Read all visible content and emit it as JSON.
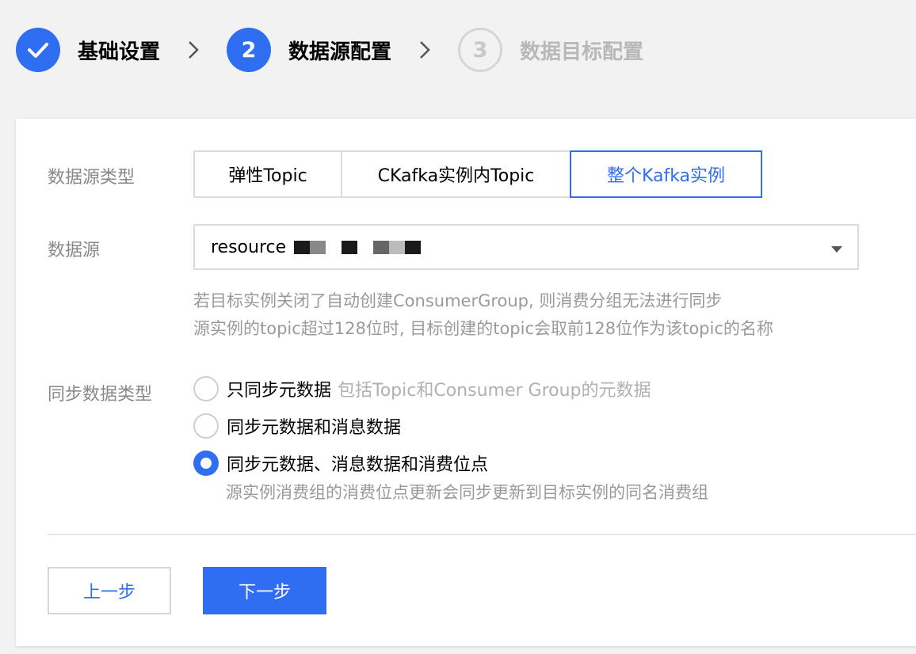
{
  "stepper": {
    "steps": [
      {
        "number": "",
        "label": "基础设置",
        "state": "done"
      },
      {
        "number": "2",
        "label": "数据源配置",
        "state": "active"
      },
      {
        "number": "3",
        "label": "数据目标配置",
        "state": "pending"
      }
    ]
  },
  "form": {
    "source_type": {
      "label": "数据源类型",
      "options": [
        "弹性Topic",
        "CKafka实例内Topic",
        "整个Kafka实例"
      ],
      "selected": "整个Kafka实例"
    },
    "source": {
      "label": "数据源",
      "value": "resource"
    },
    "hints": [
      "若目标实例关闭了自动创建ConsumerGroup, 则消费分组无法进行同步",
      "源实例的topic超过128位时, 目标创建的topic会取前128位作为该topic的名称"
    ],
    "sync_type": {
      "label": "同步数据类型",
      "options": [
        {
          "label": "只同步元数据",
          "desc": "包括Topic和Consumer Group的元数据"
        },
        {
          "label": "同步元数据和消息数据",
          "desc": ""
        },
        {
          "label": "同步元数据、消息数据和消费位点",
          "desc": "源实例消费组的消费位点更新会同步更新到目标实例的同名消费组"
        }
      ],
      "selected_index": 2
    }
  },
  "buttons": {
    "prev": "上一步",
    "next": "下一步"
  },
  "colors": {
    "accent": "#2f6ef0",
    "muted_text": "#888888",
    "border": "#dcdcdc"
  }
}
